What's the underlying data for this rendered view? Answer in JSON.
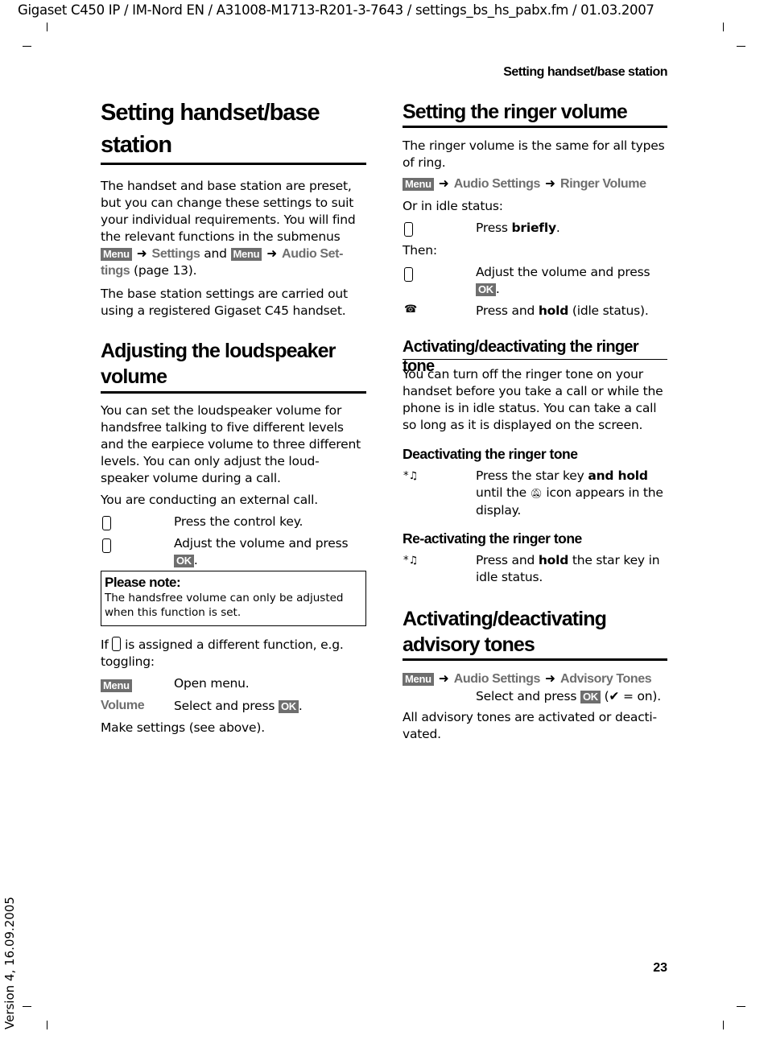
{
  "header": {
    "doc_info": "Gigaset C450 IP / IM-Nord EN / A31008-M1713-R201-3-7643 / settings_bs_hs_pabx.fm / 01.03.2007",
    "running_title": "Setting handset/base station",
    "page_number": "23",
    "version": "Version 4, 16.09.2005"
  },
  "keys": {
    "menu": "Menu",
    "ok": "OK"
  },
  "left": {
    "title": "Setting handset/base station",
    "intro": {
      "t1": "The handset and base station are preset, but you can change these settings to suit your individual requirements. You will find the relevant functions in the submenus",
      "l1": "Settings",
      "t2": "and",
      "l2": "Audio Set-tings",
      "t3": "(page 13)."
    },
    "base_note": "The base station settings are carried out using a registered Gigaset C45 handset.",
    "section_title": "Adjusting the loudspeaker volume",
    "section_text": "You can set the loudspeaker volume for handsfree talking to five different levels and the earpiece volume to three different levels. You can only adjust the loud-speaker volume during a call.",
    "call_text": "You are conducting an external call.",
    "step1": "Press the control key.",
    "step2": "Adjust the volume and press",
    "note_title": "Please note:",
    "note_text": "The handsfree volume can only be adjusted when this function is set.",
    "if_t1": "If",
    "if_t2": "is assigned a different function, e.g. toggling:",
    "menu_step": "Open menu.",
    "volume_label": "Volume",
    "volume_step": "Select and press",
    "make": "Make settings (see above)."
  },
  "right": {
    "title": "Setting the ringer volume",
    "text": "The ringer volume is the same for all types of ring.",
    "path": [
      "Audio Settings",
      "Ringer Volume"
    ],
    "idle": "Or in idle status:",
    "press": "Press",
    "briefly": "briefly",
    "then": "Then:",
    "adjust": "Adjust the volume and press",
    "hold_t1": "Press and",
    "hold": "hold",
    "hold_t2": "(idle status).",
    "sub_title": "Activating/deactivating the ringer tone",
    "sub_text": "You can turn off the ringer tone on your handset before you take a call or while the phone is in idle status. You can take a call so long as it is displayed on the screen.",
    "deact_title": "Deactivating the ringer tone",
    "deact_t1": "Press the star key",
    "deact_and_hold": "and hold",
    "deact_t2": "until the",
    "deact_t3": "icon appears in the display.",
    "react_title": "Re-activating the ringer tone",
    "react_t1": "Press and",
    "react_hold": "hold",
    "react_t2": "the star key in idle status.",
    "adv_title": "Activating/deactivating advisory tones",
    "adv_path": [
      "Audio Settings",
      "Advisory Tones"
    ],
    "adv_select": "Select and press",
    "adv_on": "= on).",
    "adv_text": "All advisory tones are activated or deacti-vated."
  }
}
